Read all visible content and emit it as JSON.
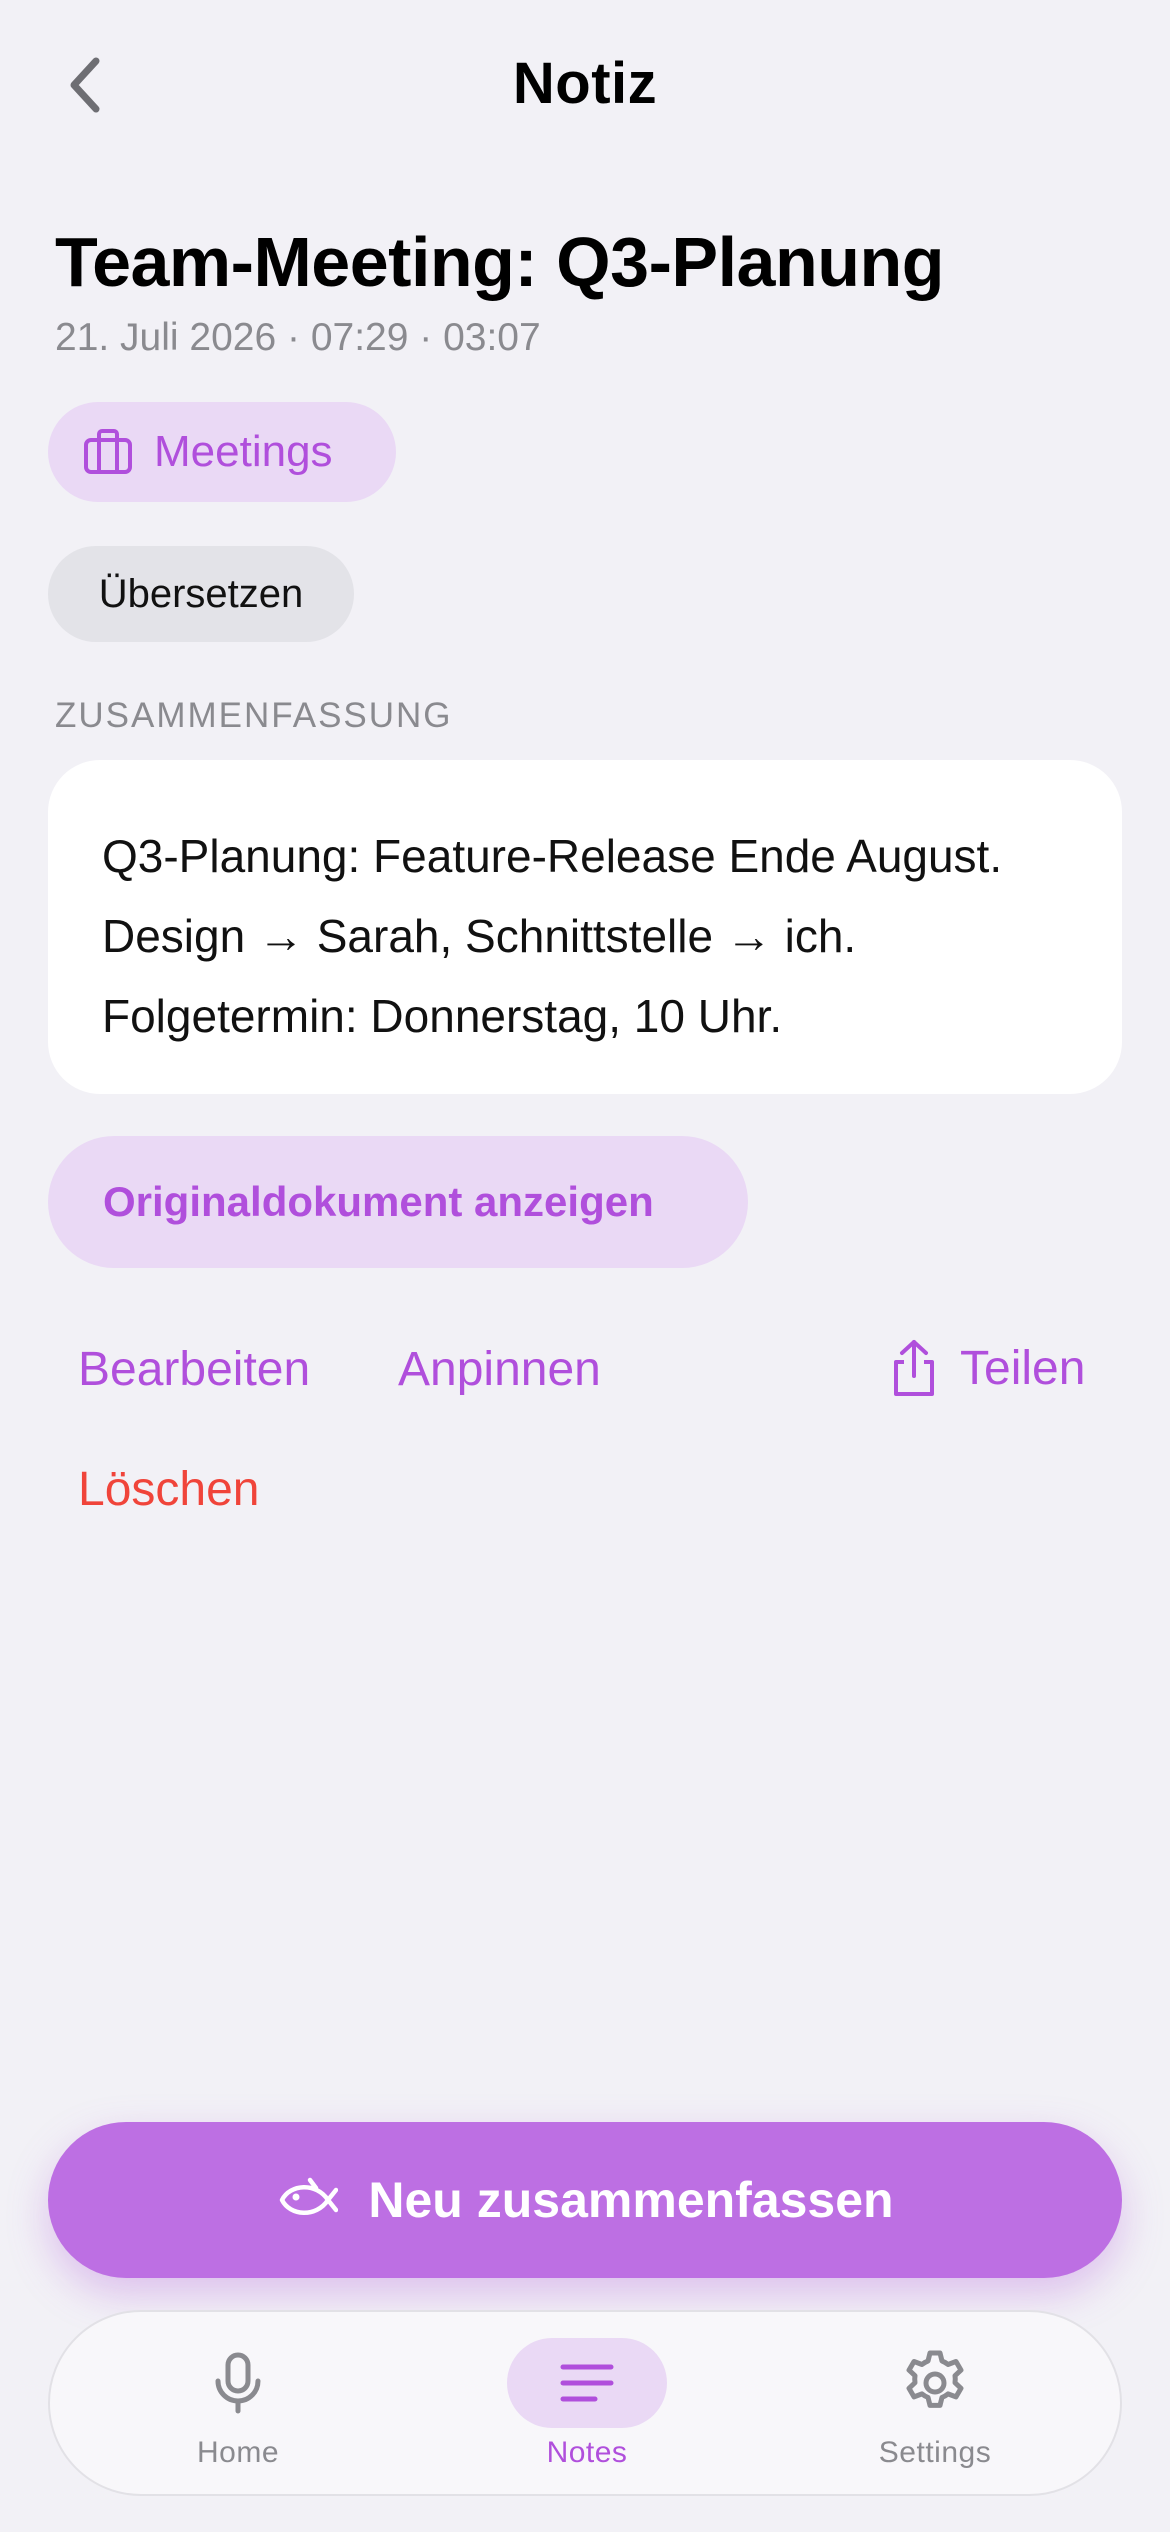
{
  "nav": {
    "title": "Notiz"
  },
  "note": {
    "title": "Team-Meeting: Q3-Planung",
    "meta": "21. Juli 2026 · 07:29 · 03:07",
    "category": "Meetings",
    "translate_label": "Übersetzen"
  },
  "summary": {
    "section_header": "ZUSAMMENFASSUNG",
    "text": "Q3-Planung: Feature-Release Ende August. Design → Sarah, Schnittstelle → ich. Folgetermin: Donnerstag, 10 Uhr."
  },
  "actions": {
    "original_doc": "Originaldokument anzeigen",
    "edit": "Bearbeiten",
    "pin": "Anpinnen",
    "share": "Teilen",
    "delete": "Löschen"
  },
  "primary_button": {
    "label": "Neu zusammenfassen"
  },
  "tabbar": {
    "items": [
      {
        "label": "Home",
        "icon": "microphone-icon"
      },
      {
        "label": "Notes",
        "icon": "notes-icon",
        "active": true
      },
      {
        "label": "Settings",
        "icon": "gear-icon"
      }
    ]
  },
  "colors": {
    "accent": "#b04fdc",
    "accent_light": "#ead9f5",
    "primary_button": "#bd6fe3",
    "destructive": "#f0443a",
    "background": "#f2f1f6"
  }
}
